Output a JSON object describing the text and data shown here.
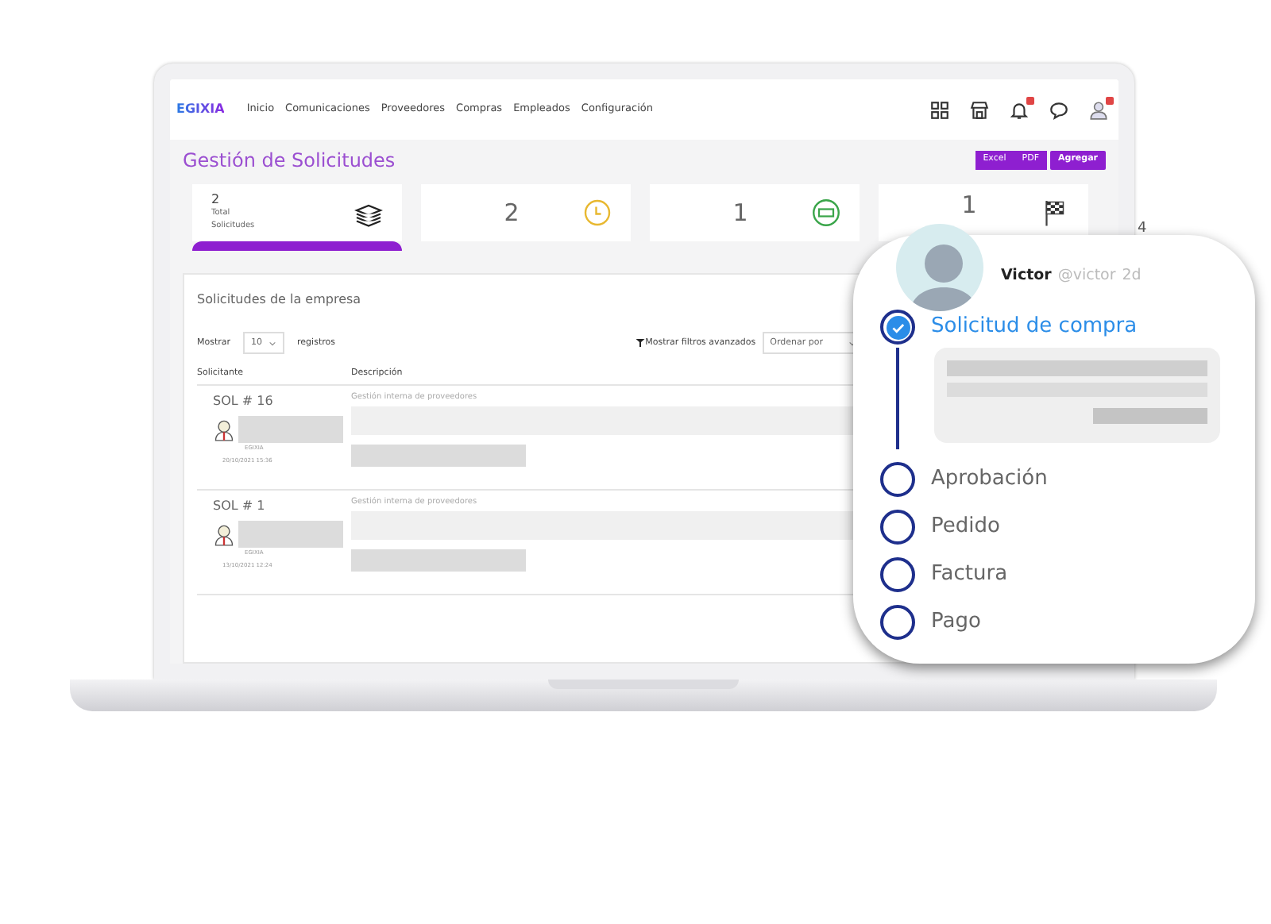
{
  "app": {
    "logo": "EGIXIA",
    "nav": [
      "Inicio",
      "Comunicaciones",
      "Proveedores",
      "Compras",
      "Empleados",
      "Configuración"
    ],
    "toolbar_icons": [
      {
        "kind": "grid",
        "badge": false
      },
      {
        "kind": "store",
        "badge": false
      },
      {
        "kind": "bell",
        "badge": true
      },
      {
        "kind": "chat",
        "badge": false
      },
      {
        "kind": "user",
        "badge": true
      }
    ]
  },
  "page": {
    "title": "Gestión de Solicitudes",
    "export_buttons": [
      "Excel",
      "PDF"
    ],
    "primary_button": "Agregar"
  },
  "stats": [
    {
      "value": "2",
      "label": "Total Solicitudes",
      "kind": "layers",
      "selected": true
    },
    {
      "value": "2",
      "kind": "clock",
      "selected": false
    },
    {
      "value": "1",
      "kind": "cash",
      "selected": false
    },
    {
      "value": "1",
      "kind": "flag",
      "selected": false
    }
  ],
  "stat_partial": "4",
  "table": {
    "title": "Solicitudes de la empresa",
    "show_label": "Mostrar",
    "page_size": "10",
    "records_label": "registros",
    "filters_link": "Mostrar filtros avanzados",
    "sort_placeholder": "Ordenar por",
    "columns": [
      "Solicitante",
      "Descripción"
    ],
    "rows": [
      {
        "id": "SOL # 16",
        "company": "EGIXIA",
        "date": "20/10/2021 15:36",
        "description": "Gestión interna de proveedores"
      },
      {
        "id": "SOL # 1",
        "company": "EGIXIA",
        "date": "13/10/2021 12:24",
        "description": "Gestión interna de proveedores"
      }
    ]
  },
  "overlay": {
    "user": "Victor",
    "handle": "@victor",
    "time": "2d",
    "steps": [
      {
        "label": "Solicitud de compra",
        "completed": true
      },
      {
        "label": "Aprobación",
        "completed": false
      },
      {
        "label": "Pedido",
        "completed": false
      },
      {
        "label": "Factura",
        "completed": false
      },
      {
        "label": "Pago",
        "completed": false
      }
    ]
  }
}
